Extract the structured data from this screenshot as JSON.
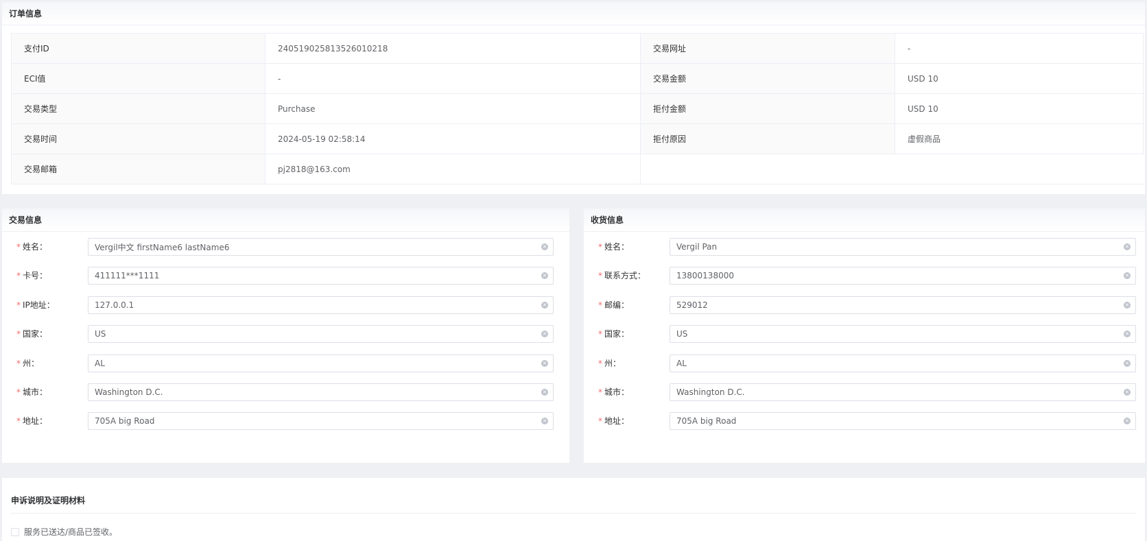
{
  "order_info": {
    "title": "订单信息",
    "rows": [
      {
        "label1": "支付ID",
        "value1": "240519025813526010218",
        "label2": "交易网址",
        "value2": "-"
      },
      {
        "label1": "ECI值",
        "value1": "-",
        "label2": "交易金额",
        "value2": "USD 10"
      },
      {
        "label1": "交易类型",
        "value1": "Purchase",
        "label2": "拒付金额",
        "value2": "USD 10"
      },
      {
        "label1": "交易时间",
        "value1": "2024-05-19 02:58:14",
        "label2": "拒付原因",
        "value2": "虚假商品"
      },
      {
        "label1": "交易邮箱",
        "value1": "pj2818@163.com"
      }
    ]
  },
  "trade_info": {
    "title": "交易信息",
    "fields": [
      {
        "label": "姓名",
        "value": "Vergil中文 firstName6 lastName6"
      },
      {
        "label": "卡号",
        "value": "411111***1111"
      },
      {
        "label": "IP地址",
        "value": "127.0.0.1"
      },
      {
        "label": "国家",
        "value": "US"
      },
      {
        "label": "州",
        "value": "AL"
      },
      {
        "label": "城市",
        "value": "Washington D.C."
      },
      {
        "label": "地址",
        "value": "705A big Road"
      }
    ]
  },
  "shipping_info": {
    "title": "收货信息",
    "fields": [
      {
        "label": "姓名",
        "value": "Vergil Pan"
      },
      {
        "label": "联系方式",
        "value": "13800138000"
      },
      {
        "label": "邮编",
        "value": "529012"
      },
      {
        "label": "国家",
        "value": "US"
      },
      {
        "label": "州",
        "value": "AL"
      },
      {
        "label": "城市",
        "value": "Washington D.C."
      },
      {
        "label": "地址",
        "value": "705A big Road"
      }
    ]
  },
  "form_common": {
    "required_mark": "*",
    "colon": "："
  },
  "appeal": {
    "title": "申诉说明及证明材料",
    "checkbox_label": "服务已送达/商品已签收。",
    "checked": false
  },
  "icons": {
    "clear": "circle-close-icon"
  }
}
